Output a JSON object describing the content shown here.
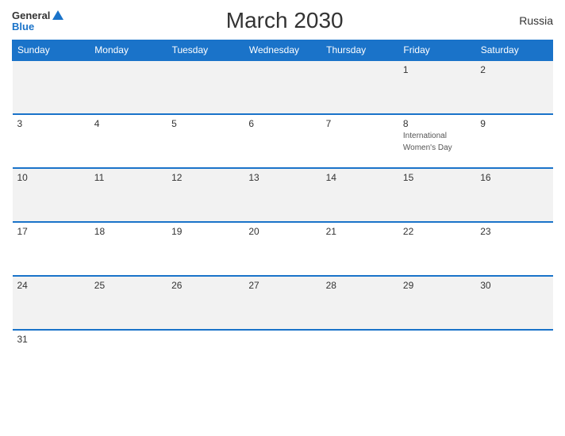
{
  "header": {
    "logo_general": "General",
    "logo_blue": "Blue",
    "title": "March 2030",
    "country": "Russia"
  },
  "weekdays": [
    "Sunday",
    "Monday",
    "Tuesday",
    "Wednesday",
    "Thursday",
    "Friday",
    "Saturday"
  ],
  "weeks": [
    [
      {
        "day": "",
        "event": ""
      },
      {
        "day": "",
        "event": ""
      },
      {
        "day": "",
        "event": ""
      },
      {
        "day": "",
        "event": ""
      },
      {
        "day": "",
        "event": ""
      },
      {
        "day": "1",
        "event": ""
      },
      {
        "day": "2",
        "event": ""
      }
    ],
    [
      {
        "day": "3",
        "event": ""
      },
      {
        "day": "4",
        "event": ""
      },
      {
        "day": "5",
        "event": ""
      },
      {
        "day": "6",
        "event": ""
      },
      {
        "day": "7",
        "event": ""
      },
      {
        "day": "8",
        "event": "International Women's Day"
      },
      {
        "day": "9",
        "event": ""
      }
    ],
    [
      {
        "day": "10",
        "event": ""
      },
      {
        "day": "11",
        "event": ""
      },
      {
        "day": "12",
        "event": ""
      },
      {
        "day": "13",
        "event": ""
      },
      {
        "day": "14",
        "event": ""
      },
      {
        "day": "15",
        "event": ""
      },
      {
        "day": "16",
        "event": ""
      }
    ],
    [
      {
        "day": "17",
        "event": ""
      },
      {
        "day": "18",
        "event": ""
      },
      {
        "day": "19",
        "event": ""
      },
      {
        "day": "20",
        "event": ""
      },
      {
        "day": "21",
        "event": ""
      },
      {
        "day": "22",
        "event": ""
      },
      {
        "day": "23",
        "event": ""
      }
    ],
    [
      {
        "day": "24",
        "event": ""
      },
      {
        "day": "25",
        "event": ""
      },
      {
        "day": "26",
        "event": ""
      },
      {
        "day": "27",
        "event": ""
      },
      {
        "day": "28",
        "event": ""
      },
      {
        "day": "29",
        "event": ""
      },
      {
        "day": "30",
        "event": ""
      }
    ],
    [
      {
        "day": "31",
        "event": ""
      },
      {
        "day": "",
        "event": ""
      },
      {
        "day": "",
        "event": ""
      },
      {
        "day": "",
        "event": ""
      },
      {
        "day": "",
        "event": ""
      },
      {
        "day": "",
        "event": ""
      },
      {
        "day": "",
        "event": ""
      }
    ]
  ]
}
